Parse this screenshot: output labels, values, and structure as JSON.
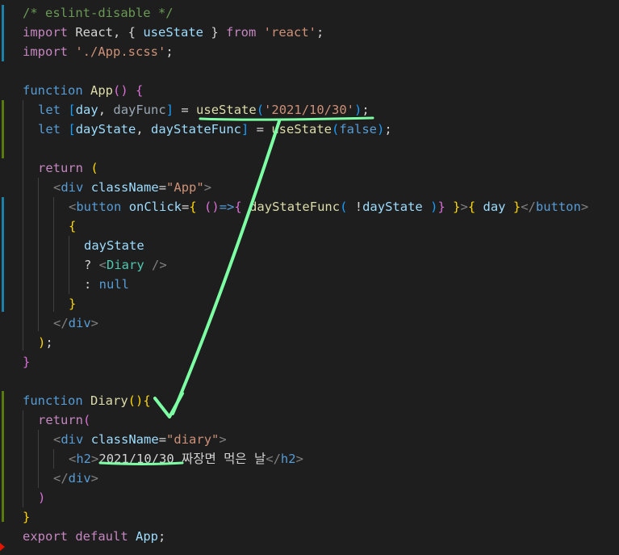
{
  "editor": {
    "line0": "/* eslint-disable */",
    "line1": [
      "import",
      " React, { ",
      "useState",
      " } ",
      "from",
      " ",
      "'react'",
      ";"
    ],
    "line2": [
      "import",
      " ",
      "'./App.scss'",
      ";"
    ],
    "line4": [
      "function",
      " ",
      "App",
      "()",
      " ",
      "{"
    ],
    "line5": [
      "let",
      " ",
      "[",
      "day",
      ", ",
      "dayFunc",
      "]",
      " = ",
      "useState",
      "(",
      "'2021/10/30'",
      ")",
      ";"
    ],
    "line6": [
      "let",
      " ",
      "[",
      "dayState",
      ", ",
      "dayStateFunc",
      "]",
      " = ",
      "useState",
      "(",
      "false",
      ")",
      ";"
    ],
    "line8": [
      "return",
      " ",
      "("
    ],
    "line9": [
      "<",
      "div",
      " ",
      "className",
      "=",
      "\"App\"",
      ">"
    ],
    "line10": [
      "<",
      "button",
      " ",
      "onClick",
      "=",
      "{",
      " ",
      "()",
      "=>",
      "{",
      " ",
      "dayStateFunc",
      "(",
      " ",
      "!",
      "dayState",
      " ",
      ")",
      "}",
      " ",
      "}",
      ">",
      "{",
      " ",
      "day",
      " ",
      "}",
      "</",
      "button",
      ">"
    ],
    "line11": "{",
    "line12": "dayState",
    "line13": [
      "? ",
      "<",
      "Diary",
      " />"
    ],
    "line14": [
      ": ",
      "null"
    ],
    "line15": "}",
    "line16": [
      "</",
      "div",
      ">"
    ],
    "line17": [
      ")",
      ";"
    ],
    "line18": "}",
    "line20": [
      "function",
      " ",
      "Diary",
      "()",
      "{"
    ],
    "line21": [
      "return",
      "("
    ],
    "line22": [
      "<",
      "div",
      " ",
      "className",
      "=",
      "\"diary\"",
      ">"
    ],
    "line23": [
      "<",
      "h2",
      ">",
      "2021/10/30 짜장면 먹은 날",
      "</",
      "h2",
      ">"
    ],
    "line24": [
      "</",
      "div",
      ">"
    ],
    "line25": ")",
    "line26": "}",
    "line27": [
      "export",
      " ",
      "default",
      " ",
      "App",
      ";"
    ]
  },
  "colors": {
    "background": "#1e1e1e",
    "keyword": "#569cd6",
    "control": "#c586c0",
    "string": "#ce9178",
    "comment": "#6a9955",
    "variable": "#9cdcfe",
    "function": "#dcdcaa",
    "annotation": "#7dffa3",
    "gutter_modified": "#1b81a8",
    "gutter_added": "#587c0c"
  }
}
